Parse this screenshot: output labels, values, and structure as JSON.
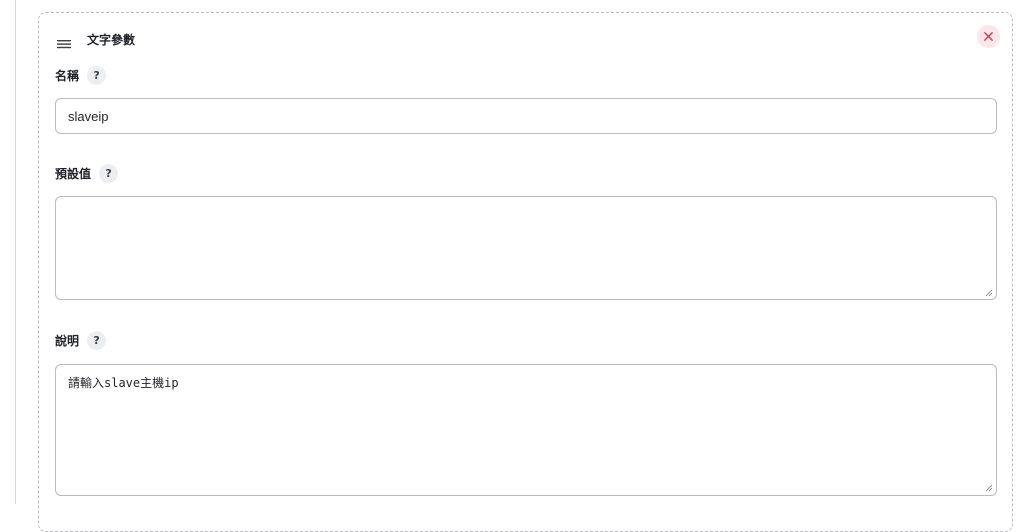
{
  "card": {
    "title": "文字參數",
    "icons": {
      "drag": "drag-handle-icon",
      "close": "close-icon",
      "help": "help-icon"
    },
    "close_color": "#e0344f"
  },
  "fields": {
    "name": {
      "label": "名稱",
      "help": "?",
      "value": "slaveip"
    },
    "default": {
      "label": "預設值",
      "help": "?",
      "value": ""
    },
    "description": {
      "label": "說明",
      "help": "?",
      "value": "請輸入slave主機ip"
    }
  }
}
